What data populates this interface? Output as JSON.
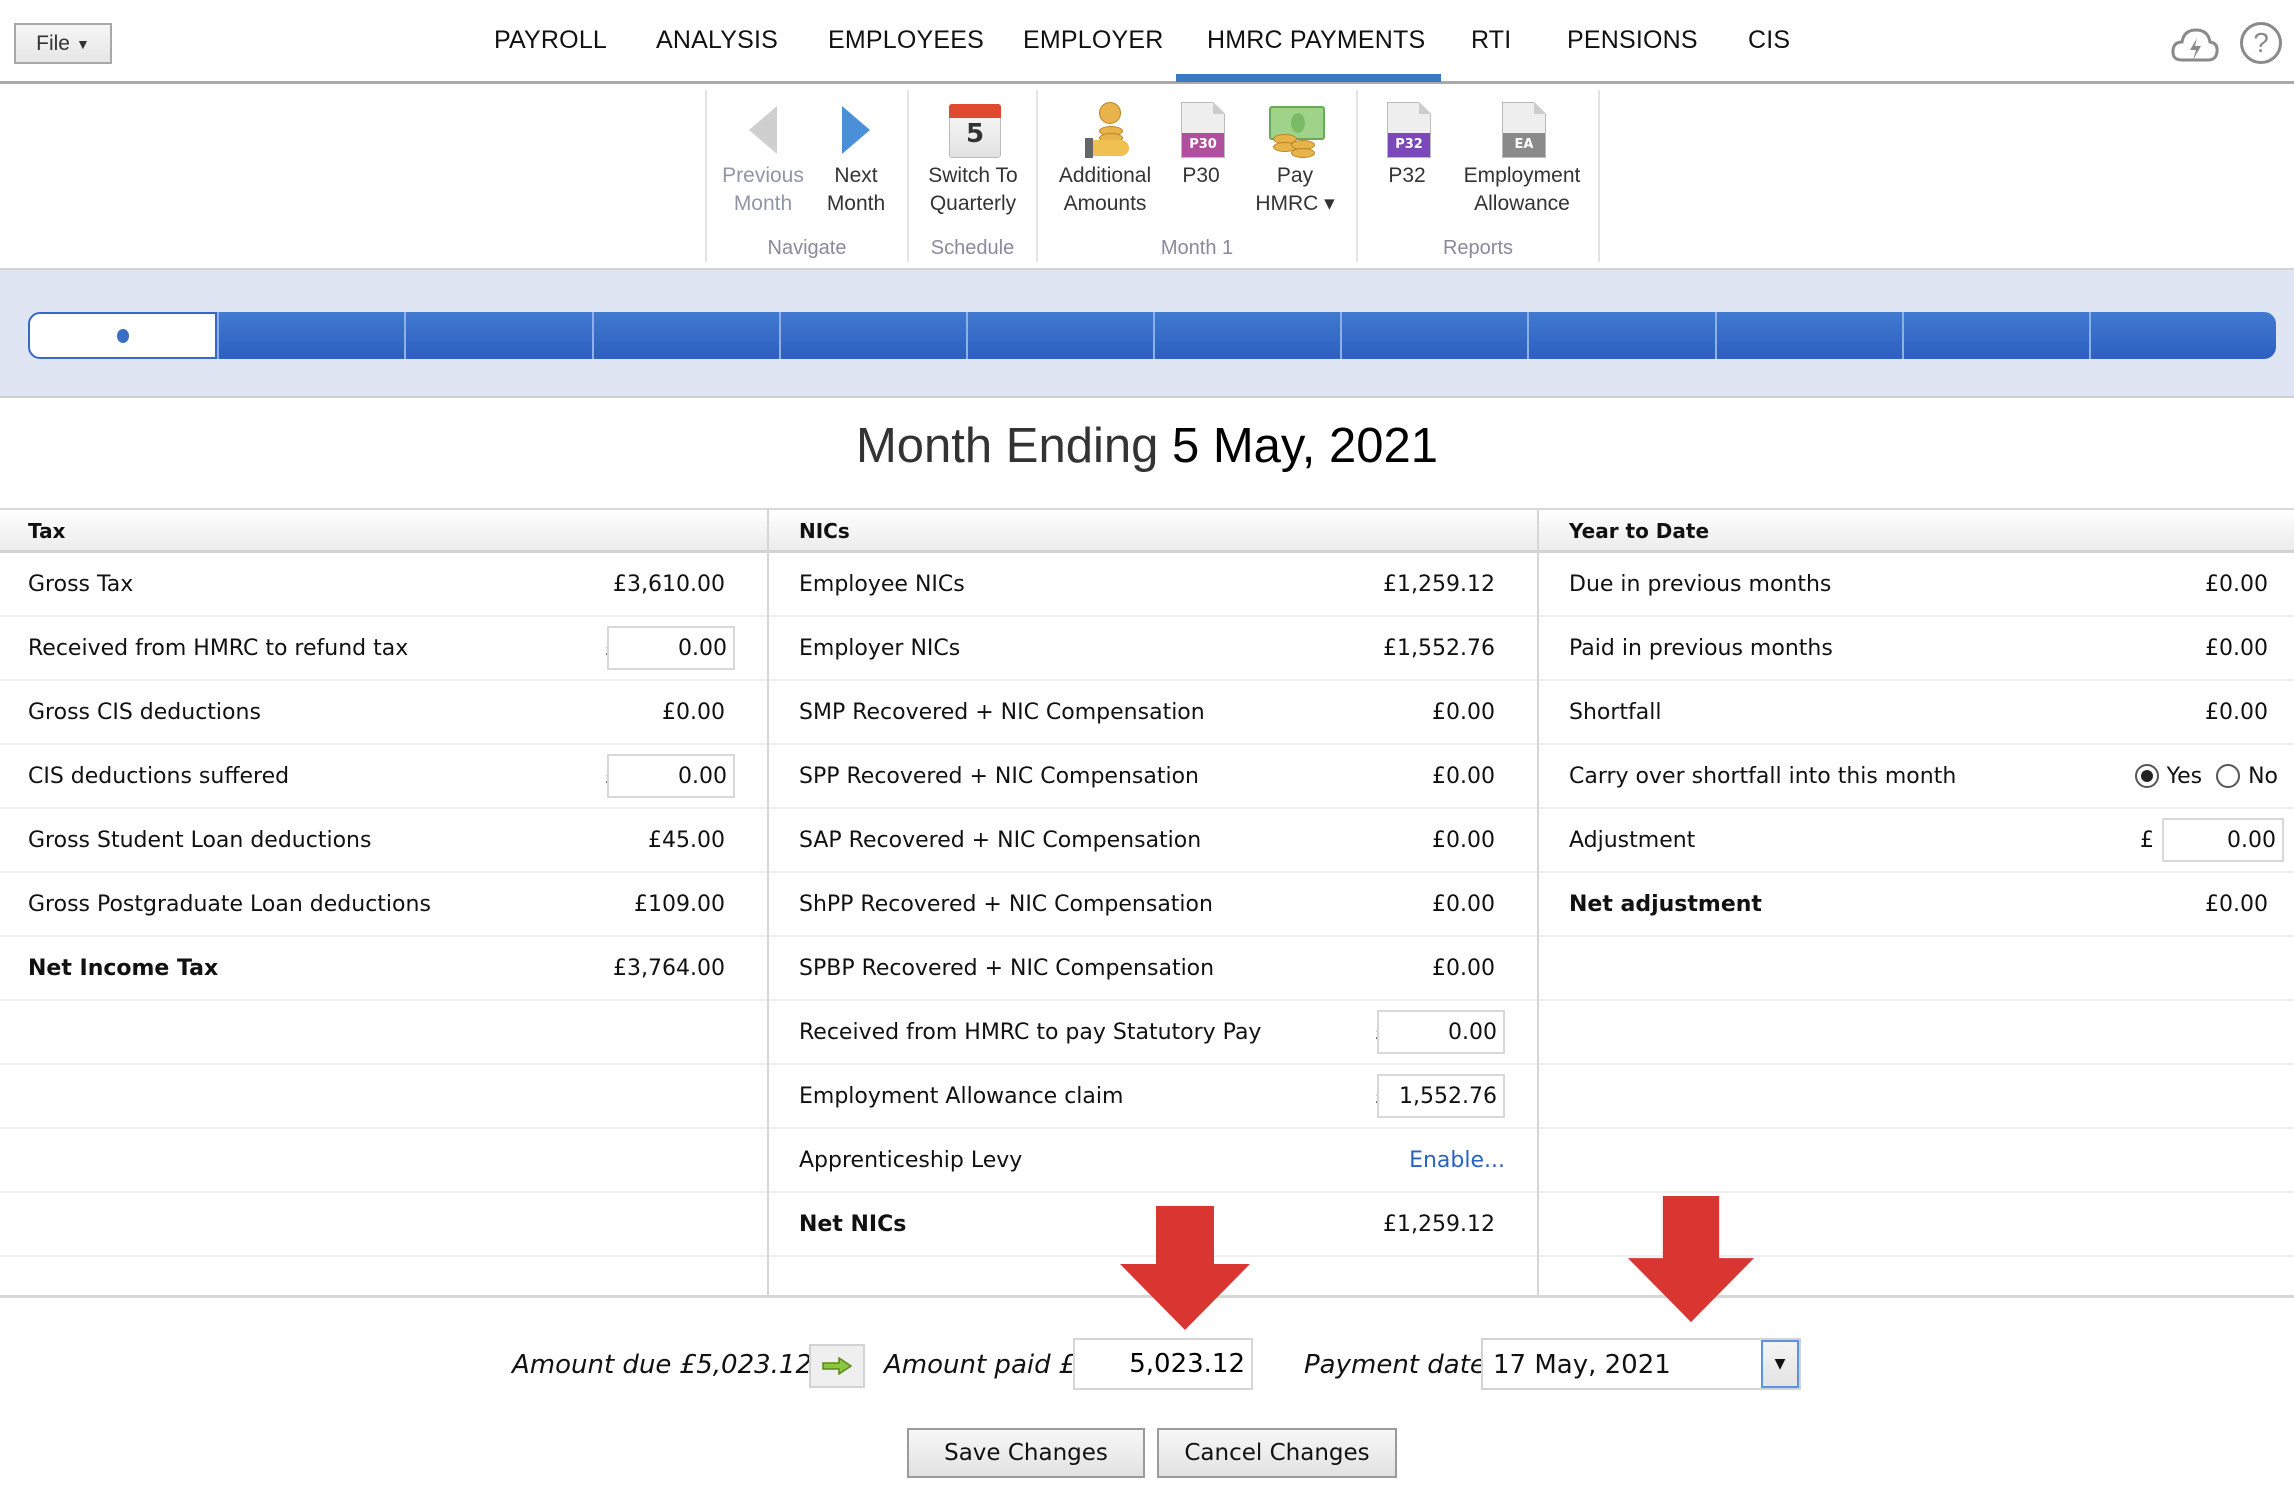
{
  "topbar": {
    "file_label": "File",
    "tabs": [
      {
        "label": "PAYROLL",
        "active": false
      },
      {
        "label": "ANALYSIS",
        "active": false
      },
      {
        "label": "EMPLOYEES",
        "active": false
      },
      {
        "label": "EMPLOYER",
        "active": false
      },
      {
        "label": "HMRC PAYMENTS",
        "active": true
      },
      {
        "label": "RTI",
        "active": false
      },
      {
        "label": "PENSIONS",
        "active": false
      },
      {
        "label": "CIS",
        "active": false
      }
    ],
    "help_glyph": "?",
    "icons": [
      "cloud-sync-icon",
      "help-icon"
    ],
    "accent_color": "#3a78c4"
  },
  "ribbon": {
    "groups": [
      {
        "label": "Navigate",
        "buttons": [
          {
            "line1": "Previous",
            "line2": "Month",
            "icon": "arrow-left-icon",
            "enabled": false
          },
          {
            "line1": "Next",
            "line2": "Month",
            "icon": "arrow-right-icon",
            "enabled": true
          }
        ]
      },
      {
        "label": "Schedule",
        "buttons": [
          {
            "line1": "Switch To",
            "line2": "Quarterly",
            "icon": "calendar-icon",
            "icon_text": "5",
            "enabled": true
          }
        ]
      },
      {
        "label": "Month 1",
        "buttons": [
          {
            "line1": "Additional",
            "line2": "Amounts",
            "icon": "coins-hand-icon",
            "enabled": true
          },
          {
            "line1": "P30",
            "line2": "",
            "icon": "p30-document-icon",
            "icon_text": "P30",
            "enabled": true
          },
          {
            "line1": "Pay",
            "line2": "HMRC ▾",
            "icon": "money-icon",
            "enabled": true
          }
        ]
      },
      {
        "label": "Reports",
        "buttons": [
          {
            "line1": "P32",
            "line2": "",
            "icon": "p32-document-icon",
            "icon_text": "P32",
            "enabled": true
          },
          {
            "line1": "Employment",
            "line2": "Allowance",
            "icon": "ea-document-icon",
            "icon_text": "EA",
            "enabled": true
          }
        ]
      }
    ]
  },
  "timeline": {
    "months_total": 12,
    "current_month": 1
  },
  "title": {
    "prefix": "Month Ending",
    "date": "5 May, 2021"
  },
  "tax": {
    "header": "Tax",
    "rows": [
      {
        "label": "Gross Tax",
        "value": "£3,610.00"
      },
      {
        "label": "Received from HMRC to refund tax",
        "currency": "£",
        "input": "0.00"
      },
      {
        "label": "Gross CIS deductions",
        "value": "£0.00"
      },
      {
        "label": "CIS deductions suffered",
        "currency": "£",
        "input": "0.00"
      },
      {
        "label": "Gross Student Loan deductions",
        "value": "£45.00"
      },
      {
        "label": "Gross Postgraduate Loan deductions",
        "value": "£109.00"
      },
      {
        "label": "Net Income Tax",
        "value": "£3,764.00",
        "bold": true
      }
    ]
  },
  "nics": {
    "header": "NICs",
    "rows": [
      {
        "label": "Employee NICs",
        "value": "£1,259.12"
      },
      {
        "label": "Employer NICs",
        "value": "£1,552.76"
      },
      {
        "label": "SMP Recovered + NIC Compensation",
        "value": "£0.00"
      },
      {
        "label": "SPP Recovered + NIC Compensation",
        "value": "£0.00"
      },
      {
        "label": "SAP Recovered + NIC Compensation",
        "value": "£0.00"
      },
      {
        "label": "ShPP Recovered + NIC Compensation",
        "value": "£0.00"
      },
      {
        "label": "SPBP Recovered + NIC Compensation",
        "value": "£0.00"
      },
      {
        "label": "Received from HMRC to pay Statutory Pay",
        "currency": "£",
        "input": "0.00"
      },
      {
        "label": "Employment Allowance claim",
        "currency": "£",
        "input": "1,552.76"
      },
      {
        "label": "Apprenticeship Levy",
        "link": "Enable..."
      },
      {
        "label": "Net NICs",
        "value": "£1,259.12",
        "bold": true
      }
    ]
  },
  "ytd": {
    "header": "Year to Date",
    "rows": [
      {
        "label": "Due in previous months",
        "value": "£0.00"
      },
      {
        "label": "Paid in previous months",
        "value": "£0.00"
      },
      {
        "label": "Shortfall",
        "value": "£0.00"
      },
      {
        "label": "Carry over shortfall into this month",
        "radio": {
          "options": [
            "Yes",
            "No"
          ],
          "selected": "Yes"
        }
      },
      {
        "label": "Adjustment",
        "currency": "£",
        "input": "0.00"
      },
      {
        "label": "Net adjustment",
        "value": "£0.00",
        "bold": true
      }
    ]
  },
  "payment": {
    "amount_due_label": "Amount due £5,023.12",
    "amount_paid_label": "Amount paid £",
    "amount_paid_value": "5,023.12",
    "payment_date_label": "Payment date",
    "payment_date_value": "17 May, 2021",
    "save_label": "Save Changes",
    "cancel_label": "Cancel Changes"
  },
  "annotations": {
    "arrow_color": "#d93632",
    "targets": [
      "amount-paid-input",
      "payment-date-select"
    ]
  }
}
